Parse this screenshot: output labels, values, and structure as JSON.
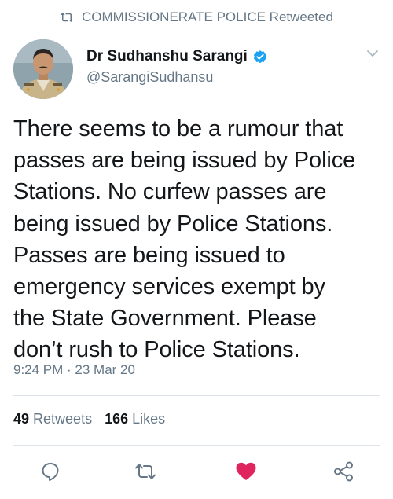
{
  "retweet_header": {
    "text": "COMMISSIONERATE POLICE Retweeted",
    "icon": "retweet-icon"
  },
  "author": {
    "name": "Dr Sudhanshu Sarangi",
    "handle": "@SarangiSudhansu",
    "verified": true,
    "avatar_icon": "avatar-photo"
  },
  "tweet": {
    "lines": [
      "There seems to be a rumour that",
      "passes are being issued by Police",
      "Stations. No curfew passes are",
      "being issued by Police Stations.",
      "Passes are being issued to",
      "emergency services exempt by",
      "the State Government. Please",
      "don’t rush to Police Stations."
    ],
    "timestamp": "9:24 PM · 23 Mar 20"
  },
  "stats": {
    "retweets_count": "49",
    "retweets_label": "Retweets",
    "likes_count": "166",
    "likes_label": "Likes"
  },
  "actions": [
    {
      "name": "reply",
      "icon": "reply-icon"
    },
    {
      "name": "retweet",
      "icon": "retweet-icon"
    },
    {
      "name": "like",
      "icon": "heart-icon",
      "active": true
    },
    {
      "name": "share",
      "icon": "share-icon"
    }
  ],
  "colors": {
    "text": "#14171a",
    "secondary": "#657786",
    "verified": "#1da1f2",
    "like_active": "#e0245e",
    "divider": "#dde3e8"
  }
}
